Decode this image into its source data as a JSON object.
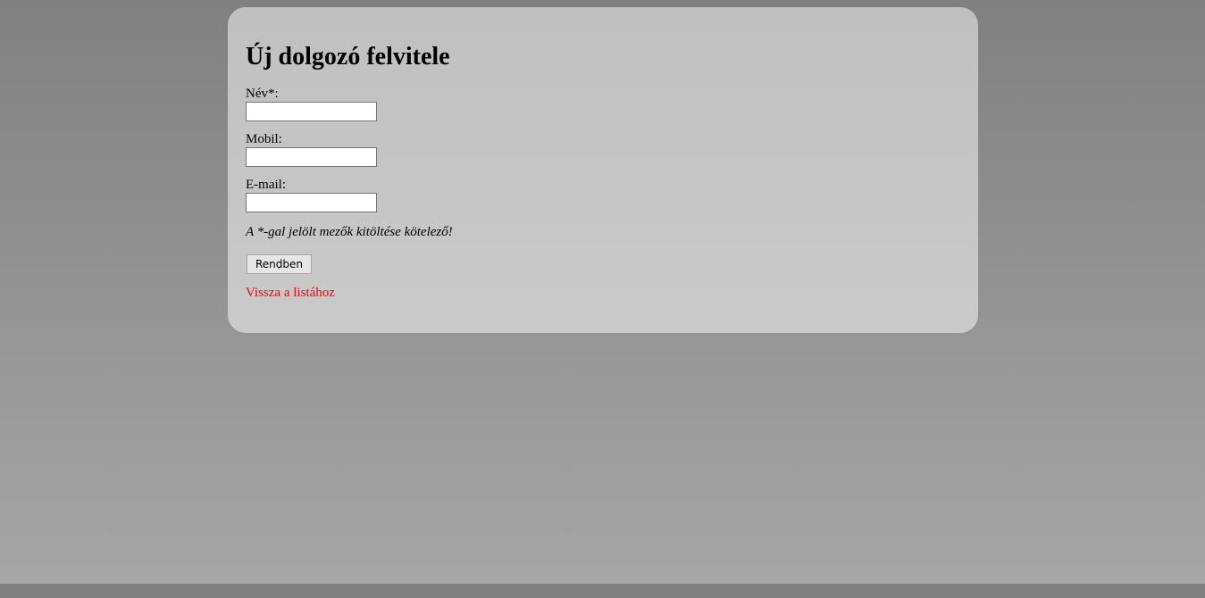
{
  "page": {
    "title": "Új dolgozó felvitele"
  },
  "form": {
    "fields": [
      {
        "label": "Név*:",
        "value": ""
      },
      {
        "label": "Mobil:",
        "value": ""
      },
      {
        "label": "E-mail:",
        "value": ""
      }
    ],
    "note": "A *-gal jelölt mezők kitöltése kötelező!",
    "submit_label": "Rendben"
  },
  "back_link": {
    "label": "Vissza a listához"
  },
  "colors": {
    "page_background": "#808080",
    "panel_background": "#c4c4c4",
    "link": "#ff0000"
  }
}
